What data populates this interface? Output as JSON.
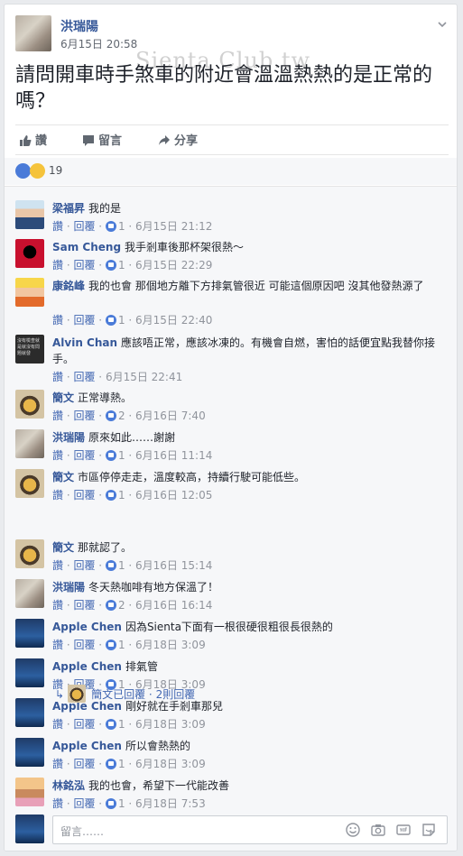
{
  "post": {
    "author": "洪瑞陽",
    "time": "6月15日 20:58",
    "watermark": "Sienta Club.tw",
    "text": "請問開車時手煞車的附近會溫溫熱熱的是正常的嗎？",
    "actions": {
      "like": "讚",
      "comment": "留言",
      "share": "分享"
    },
    "reaction_count": "19",
    "colors": {
      "link": "#365899",
      "action": "#4267b2",
      "like": "#4a7bd8"
    }
  },
  "comments": [
    {
      "author": "梁福昇",
      "text": "我的是",
      "like": "讚",
      "reply": "回覆",
      "likes": "1",
      "time": "6月15日 21:12"
    },
    {
      "author": "Sam Cheng",
      "text": "我手剎車後那杯架很熱～",
      "like": "讚",
      "reply": "回覆",
      "likes": "1",
      "time": "6月15日 22:29"
    },
    {
      "author": "康銘峰",
      "text": "我的也會 那個地方離下方排氣管很近 可能這個原因吧 沒其他發熱源了",
      "like": "讚",
      "reply": "回覆",
      "likes": "1",
      "time": "6月15日 22:40"
    },
    {
      "author": "Alvin Chan",
      "text": "應該唔正常，應該冰凍的。有機會自燃，害怕的話便宜點我替你接手。",
      "like": "讚",
      "reply": "回覆",
      "likes": "",
      "time": "6月15日 22:41"
    },
    {
      "author": "簡文",
      "text": "正常導熱。",
      "like": "讚",
      "reply": "回覆",
      "likes": "2",
      "time": "6月16日 7:40"
    },
    {
      "author": "洪瑞陽",
      "text": "原來如此……謝謝",
      "like": "讚",
      "reply": "回覆",
      "likes": "1",
      "time": "6月16日 11:14"
    },
    {
      "author": "簡文",
      "text": "市區停停走走，溫度較高，持續行駛可能低些。",
      "like": "讚",
      "reply": "回覆",
      "likes": "1",
      "time": "6月16日 12:05"
    },
    {
      "author": "簡文",
      "text": "那就認了。",
      "like": "讚",
      "reply": "回覆",
      "likes": "1",
      "time": "6月16日 15:14"
    },
    {
      "author": "洪瑞陽",
      "text": "冬天熱咖啡有地方保溫了！",
      "like": "讚",
      "reply": "回覆",
      "likes": "2",
      "time": "6月16日 16:14"
    },
    {
      "author": "Apple Chen",
      "text": "因為Sienta下面有一根很硬很粗很長很熱的",
      "like": "讚",
      "reply": "回覆",
      "likes": "1",
      "time": "6月18日 3:09"
    },
    {
      "author": "Apple Chen",
      "text": "排氣管",
      "like": "讚",
      "reply": "回覆",
      "likes": "1",
      "time": "6月18日 3:09"
    },
    {
      "author": "Apple Chen",
      "text": "剛好就在手剎車那兒",
      "like": "讚",
      "reply": "回覆",
      "likes": "1",
      "time": "6月18日 3:09"
    },
    {
      "author": "Apple Chen",
      "text": "所以會熱熱的",
      "like": "讚",
      "reply": "回覆",
      "likes": "1",
      "time": "6月18日 3:09"
    },
    {
      "author": "林銘泓",
      "text": "我的也會，希望下一代能改善",
      "like": "讚",
      "reply": "回覆",
      "likes": "1",
      "time": "6月18日 7:53"
    }
  ],
  "alvin_avatar_text": "沒有檢查就是就沒有問題就發",
  "reply_summary": {
    "text": "簡文已回覆",
    "sep": "·",
    "count": "2則回覆"
  },
  "composer": {
    "placeholder": "留言……"
  }
}
